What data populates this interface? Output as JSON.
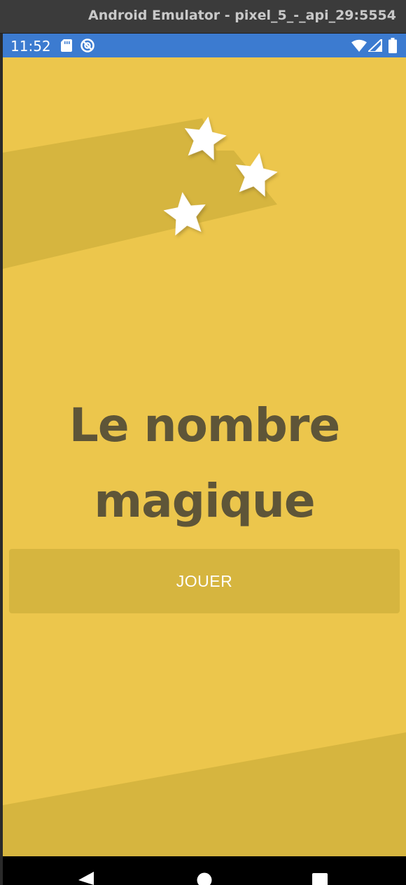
{
  "window": {
    "title": "Android Emulator - pixel_5_-_api_29:5554"
  },
  "status_bar": {
    "time": "11:52",
    "icons": [
      "sd-card-icon",
      "circle-slash-icon",
      "wifi-icon",
      "signal-icon",
      "battery-icon"
    ],
    "background_color": "#3c7bd0"
  },
  "app": {
    "background_color": "#ecc64c",
    "accent_color": "#d6b53f",
    "title_color": "#5e5538",
    "title_line1": "Le nombre",
    "title_line2": "magique",
    "play_button_label": "JOUER",
    "decoration": {
      "star_count": 3,
      "icon": "star-icon"
    }
  },
  "nav_bar": {
    "icons": [
      "back-icon",
      "home-icon",
      "recents-icon"
    ]
  }
}
